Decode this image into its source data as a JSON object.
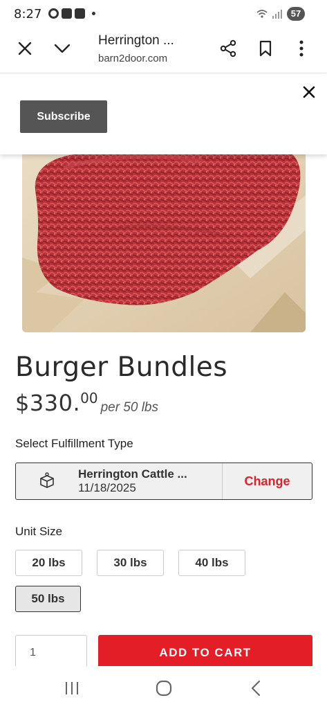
{
  "status_bar": {
    "time": "8:27",
    "battery": "57",
    "left_icons": [
      "record-icon",
      "youtube-icon",
      "youtube-icon"
    ],
    "right_icons": [
      "wifi-icon",
      "signal-icon"
    ]
  },
  "browser": {
    "title": "Herrington ...",
    "domain": "barn2door.com",
    "icons": [
      "close-icon",
      "chevron-down-icon",
      "share-icon",
      "bookmark-icon",
      "more-vert-icon"
    ]
  },
  "subscribe_panel": {
    "button_label": "Subscribe",
    "close_icon": "close-icon"
  },
  "product": {
    "title": "Burger Bundles",
    "price_dollars": "$330.",
    "price_cents": "00",
    "price_unit": "per 50 lbs"
  },
  "fulfillment": {
    "label": "Select Fulfillment Type",
    "location": "Herrington Cattle ...",
    "date": "11/18/2025",
    "change_label": "Change",
    "icon": "pickup-box-icon"
  },
  "unit_size": {
    "label": "Unit Size",
    "options": [
      "20 lbs",
      "30 lbs",
      "40 lbs",
      "50 lbs"
    ],
    "selected": "50 lbs"
  },
  "cart": {
    "quantity": "1",
    "add_label": "ADD TO CART"
  },
  "colors": {
    "accent_red": "#e31e26",
    "change_red": "#d8232a",
    "subscribe_gray": "#555555"
  },
  "nav_bar": {
    "icons": [
      "recent-apps-icon",
      "home-icon",
      "back-icon"
    ]
  }
}
